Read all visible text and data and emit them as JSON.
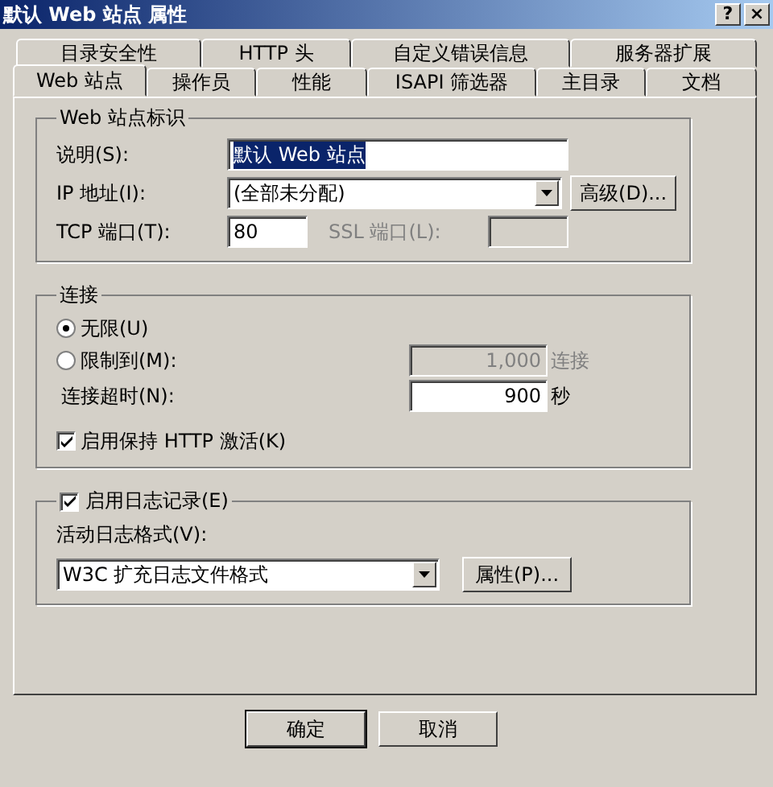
{
  "window": {
    "title": "默认 Web 站点 属性",
    "help": "?",
    "close": "×"
  },
  "tab_rows": [
    [
      {
        "label": "目录安全性",
        "selected": false
      },
      {
        "label": "HTTP 头",
        "selected": false
      },
      {
        "label": "自定义错误信息",
        "selected": false
      },
      {
        "label": "服务器扩展",
        "selected": false
      }
    ],
    [
      {
        "label": "Web 站点",
        "selected": true
      },
      {
        "label": "操作员",
        "selected": false
      },
      {
        "label": "性能",
        "selected": false
      },
      {
        "label": "ISAPI 筛选器",
        "selected": false
      },
      {
        "label": "主目录",
        "selected": false
      },
      {
        "label": "文档",
        "selected": false
      }
    ]
  ],
  "identity": {
    "title": "Web 站点标识",
    "description_label": "说明(S):",
    "description_value": "默认 Web 站点",
    "ip_label": "IP 地址(I):",
    "ip_value": "(全部未分配)",
    "advanced_button": "高级(D)...",
    "tcp_label": "TCP 端口(T):",
    "tcp_value": "80",
    "ssl_label": "SSL 端口(L):",
    "ssl_disabled": true
  },
  "connections": {
    "title": "连接",
    "options": [
      {
        "label": "无限(U)",
        "selected": true
      },
      {
        "label": "限制到(M):",
        "selected": false
      }
    ],
    "limit_value": "1,000",
    "limit_unit": "连接",
    "limit_disabled": true,
    "timeout_label": "连接超时(N):",
    "timeout_value": "900",
    "timeout_unit": "秒",
    "keepalive_label": "启用保持 HTTP 激活(K)",
    "keepalive_checked": true
  },
  "logging": {
    "label": "启用日志记录(E)",
    "checked": true,
    "format_label": "活动日志格式(V):",
    "format_value": "W3C 扩充日志文件格式",
    "properties_button": "属性(P)..."
  },
  "buttons": [
    "确定",
    "取消"
  ]
}
